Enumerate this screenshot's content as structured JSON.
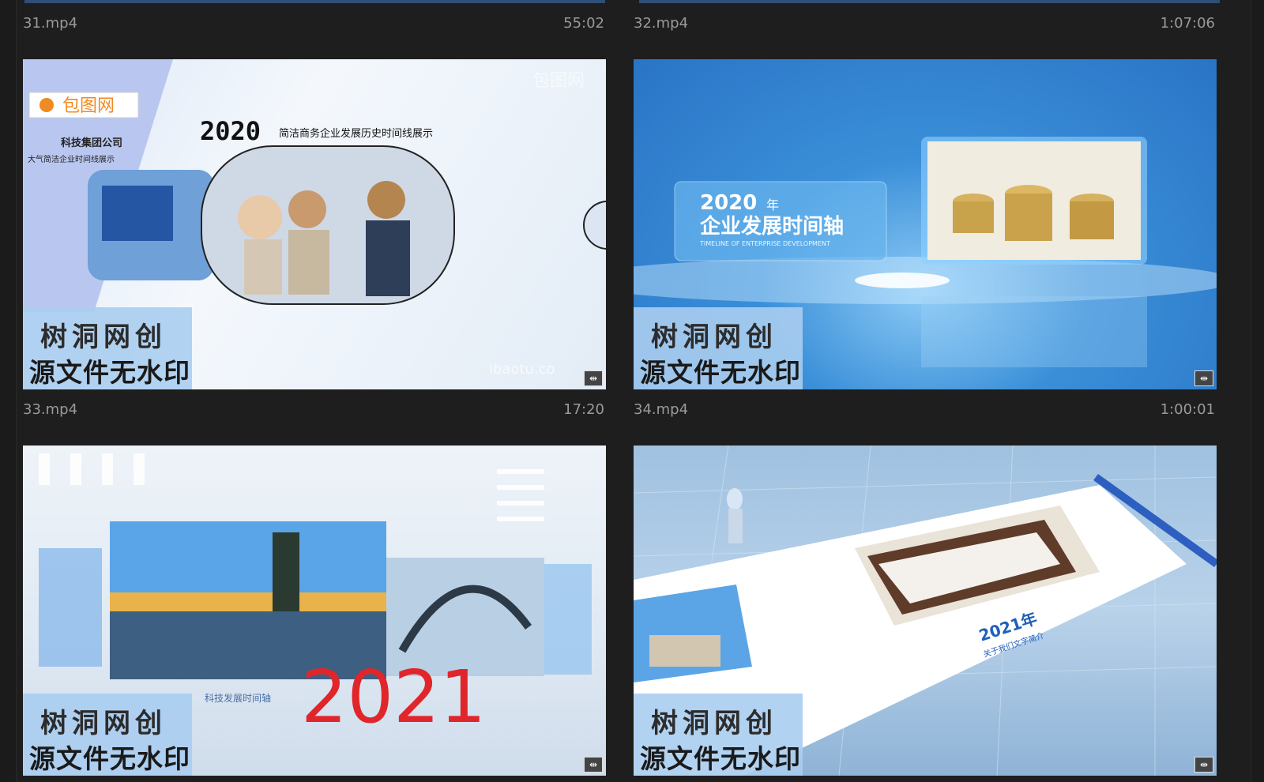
{
  "items": [
    {
      "name": "31.mp4",
      "duration": "55:02"
    },
    {
      "name": "32.mp4",
      "duration": "1:07:06"
    },
    {
      "name": "33.mp4",
      "duration": "17:20"
    },
    {
      "name": "34.mp4",
      "duration": "1:00:01"
    }
  ],
  "thumb1": {
    "logo": "包图网",
    "company": "科技集团公司",
    "subtitle": "大气简洁企业时间线展示",
    "year": "2020",
    "headline": "简洁商务企业发展历史时间线展示",
    "watermark_site": "ibaotu.co",
    "watermark_top": "包图网"
  },
  "thumb2": {
    "year": "2020",
    "year_unit": "年",
    "title": "企业发展时间轴",
    "subtitle": "TIMELINE OF ENTERPRISE DEVELOPMENT"
  },
  "thumb3": {
    "year": "2021",
    "caption": "科技发展时间轴"
  },
  "thumb4": {
    "year": "2021年",
    "caption": "关于我们文字简介"
  },
  "badge": {
    "line1": "树洞网创",
    "line2": "源文件无水印"
  }
}
